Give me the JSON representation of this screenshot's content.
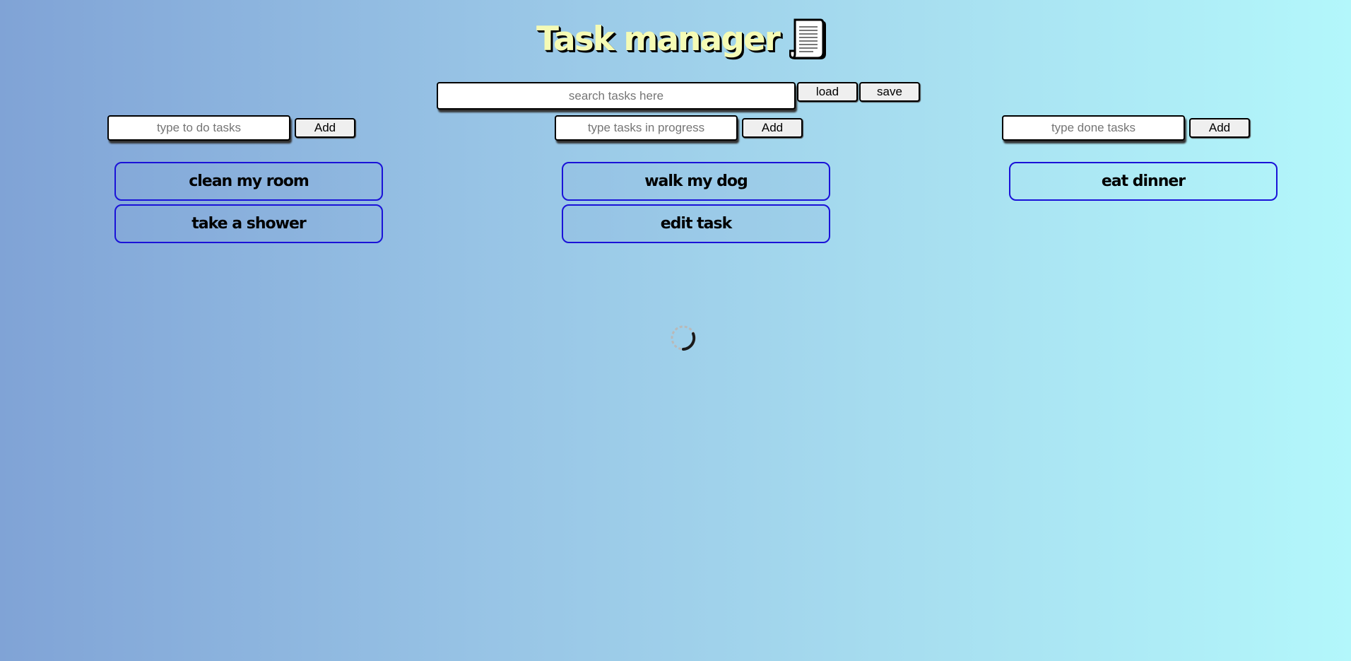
{
  "header": {
    "title": "Task manager",
    "icon": "scroll-icon"
  },
  "search": {
    "placeholder": "search tasks here",
    "value": "",
    "load_label": "load",
    "save_label": "save"
  },
  "columns": {
    "todo": {
      "placeholder": "type to do tasks",
      "add_label": "Add",
      "tasks": [
        "clean my room",
        "take a shower"
      ]
    },
    "progress": {
      "placeholder": "type tasks in progress",
      "add_label": "Add",
      "tasks": [
        "walk my dog",
        "edit task"
      ]
    },
    "done": {
      "placeholder": "type done tasks",
      "add_label": "Add",
      "tasks": [
        "eat dinner"
      ]
    }
  },
  "loading": {
    "icon": "loading-spinner-icon"
  },
  "colors": {
    "task_border": "#1a12d8",
    "title_fill": "#f5fbb5",
    "bg_left": "#80a3d6",
    "bg_right": "#b3f7fb"
  }
}
